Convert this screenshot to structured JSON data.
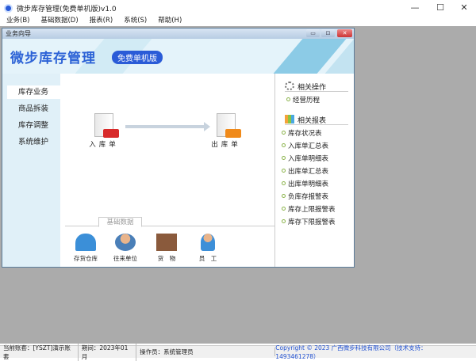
{
  "window": {
    "title": "微步库存管理(免费单机版)v1.0",
    "minimize": "—",
    "maximize": "☐",
    "close": "✕"
  },
  "menu": [
    "业务(B)",
    "基础数据(D)",
    "报表(R)",
    "系统(S)",
    "帮助(H)"
  ],
  "child": {
    "title": "业务向导",
    "min": "▭",
    "restore": "⊡",
    "close": "✕"
  },
  "banner": {
    "brand": "微步库存管理",
    "edition": "免费单机版"
  },
  "nav": [
    "库存业务",
    "商品拆装",
    "库存调整",
    "系统维护"
  ],
  "flow": {
    "in": "入库单",
    "out": "出库单"
  },
  "basic": {
    "tab": "基础数据",
    "items": [
      "存货仓库",
      "往来单位",
      "货　物",
      "员　工"
    ]
  },
  "right": {
    "ops_title": "相关操作",
    "ops": [
      "经营历程"
    ],
    "reports_title": "相关报表",
    "reports": [
      "库存状况表",
      "入库单汇总表",
      "入库单明细表",
      "出库单汇总表",
      "出库单明细表",
      "负库存报警表",
      "库存上限报警表",
      "库存下限报警表"
    ]
  },
  "status": {
    "account": "当前账套：[YSZT]演示账套",
    "period": "期间：2023年01月",
    "operator": "操作员：系统管理员",
    "copyright": "Copyright © 2023 广西微步科技有限公司（技术支持：1493461278）"
  }
}
